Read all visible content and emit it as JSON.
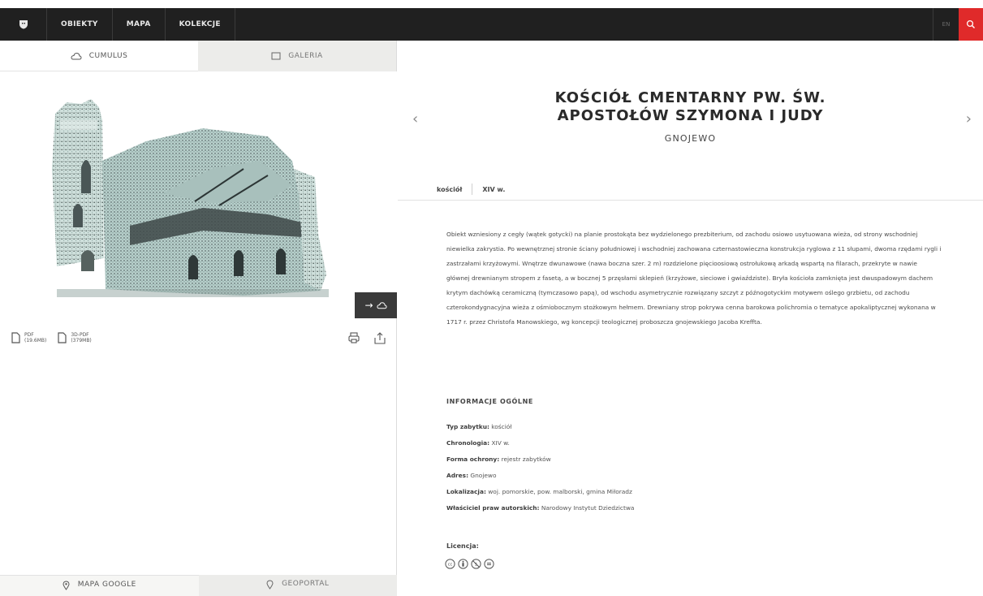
{
  "nav": {
    "items": [
      "OBIEKTY",
      "MAPA",
      "KOLEKCJE"
    ],
    "lang": "EN"
  },
  "viewer_tabs": {
    "cumulus": "CUMULUS",
    "galeria": "GALERIA"
  },
  "downloads": [
    {
      "label": "PDF",
      "size": "(19.6MB)"
    },
    {
      "label": "3D-PDF",
      "size": "(379MB)"
    }
  ],
  "map_tabs": {
    "google": "MAPA GOOGLE",
    "geoportal": "GEOPORTAL"
  },
  "object": {
    "title_line1": "KOŚCIÓŁ CMENTARNY PW. ŚW.",
    "title_line2": "APOSTOŁÓW SZYMONA I JUDY",
    "location": "GNOJEWO",
    "tags": [
      "kościół",
      "XIV w."
    ],
    "description": "Obiekt wzniesiony z cegły (wątek gotycki) na planie prostokąta bez wydzielonego prezbiterium, od zachodu osiowo usytuowana wieża, od strony wschodniej niewielka zakrystia. Po wewnętrznej stronie ściany południowej i wschodniej zachowana czternastowieczna konstrukcja ryglowa z 11 słupami, dwoma rzędami rygli i zastrzałami krzyżowymi. Wnętrze dwunawowe (nawa boczna szer. 2 m) rozdzielone pięcioosiową ostrołukową arkadą wspartą na filarach, przekryte w nawie głównej drewnianym stropem z fasetą, a w bocznej 5 przęsłami sklepień (krzyżowe, sieciowe i gwiaździste). Bryła kościoła zamknięta jest dwuspadowym dachem krytym dachówką ceramiczną (tymczasowo papą), od wschodu asymetrycznie rozwiązany szczyt z późnogotyckim motywem oślego grzbietu, od zachodu czterokondygnacyjna wieża z ośmiobocznym stożkowym hełmem. Drewniany strop pokrywa cenna barokowa polichromia o tematyce apokaliptycznej wykonana w 1717 r. przez Christofa Manowskiego, wg koncepcji teologicznej proboszcza gnojewskiego Jacoba Kreffta."
  },
  "info": {
    "heading": "INFORMACJE OGÓLNE",
    "rows": [
      {
        "label": "Typ zabytku:",
        "value": "kościół"
      },
      {
        "label": "Chronologia:",
        "value": "XIV w."
      },
      {
        "label": "Forma ochrony:",
        "value": "rejestr zabytków"
      },
      {
        "label": "Adres:",
        "value": "Gnojewo"
      },
      {
        "label": "Lokalizacja:",
        "value": "woj. pomorskie, pow. malborski, gmina Miłoradz"
      },
      {
        "label": "Właściciel praw autorskich:",
        "value": "Narodowy Instytut Dziedzictwa"
      }
    ]
  },
  "license": {
    "heading": "Licencja:",
    "icons": [
      "cc-icon",
      "by-icon",
      "nc-icon",
      "nd-icon"
    ]
  },
  "colors": {
    "topbar": "#202020",
    "search": "#e02a2a"
  }
}
